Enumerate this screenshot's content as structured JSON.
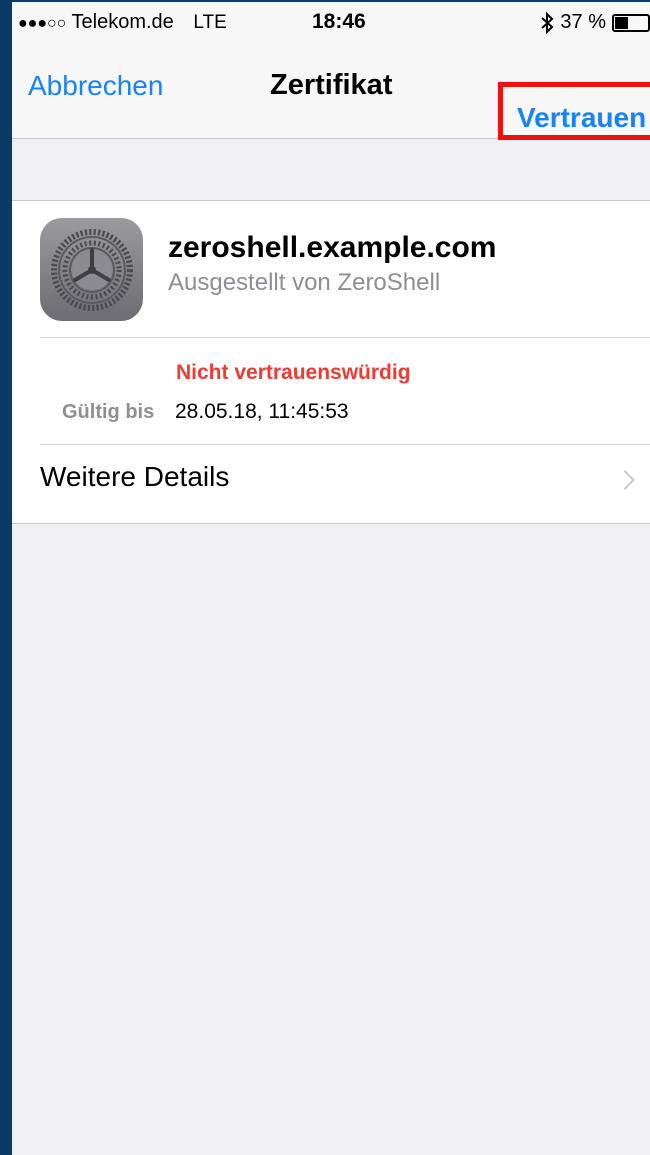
{
  "status_bar": {
    "signal_dots": "●●●○○",
    "carrier": "Telekom.de",
    "network": "LTE",
    "time": "18:46",
    "bluetooth_icon": "bluetooth-icon",
    "battery_percent": "37 %",
    "battery_level": 0.37
  },
  "nav": {
    "cancel_label": "Abbrechen",
    "title": "Zertifikat",
    "trust_label": "Vertrauen",
    "highlight_color": "#ee1111"
  },
  "certificate": {
    "icon": "settings-gear-icon",
    "name": "zeroshell.example.com",
    "issuer": "Ausgestellt von ZeroShell",
    "status": "Nicht vertrauenswürdig",
    "valid_until_label": "Gültig bis",
    "valid_until_value": "28.05.18, 11:45:53",
    "more_details_label": "Weitere Details"
  },
  "colors": {
    "accent": "#1a82fb",
    "warning": "#ef3b36"
  }
}
